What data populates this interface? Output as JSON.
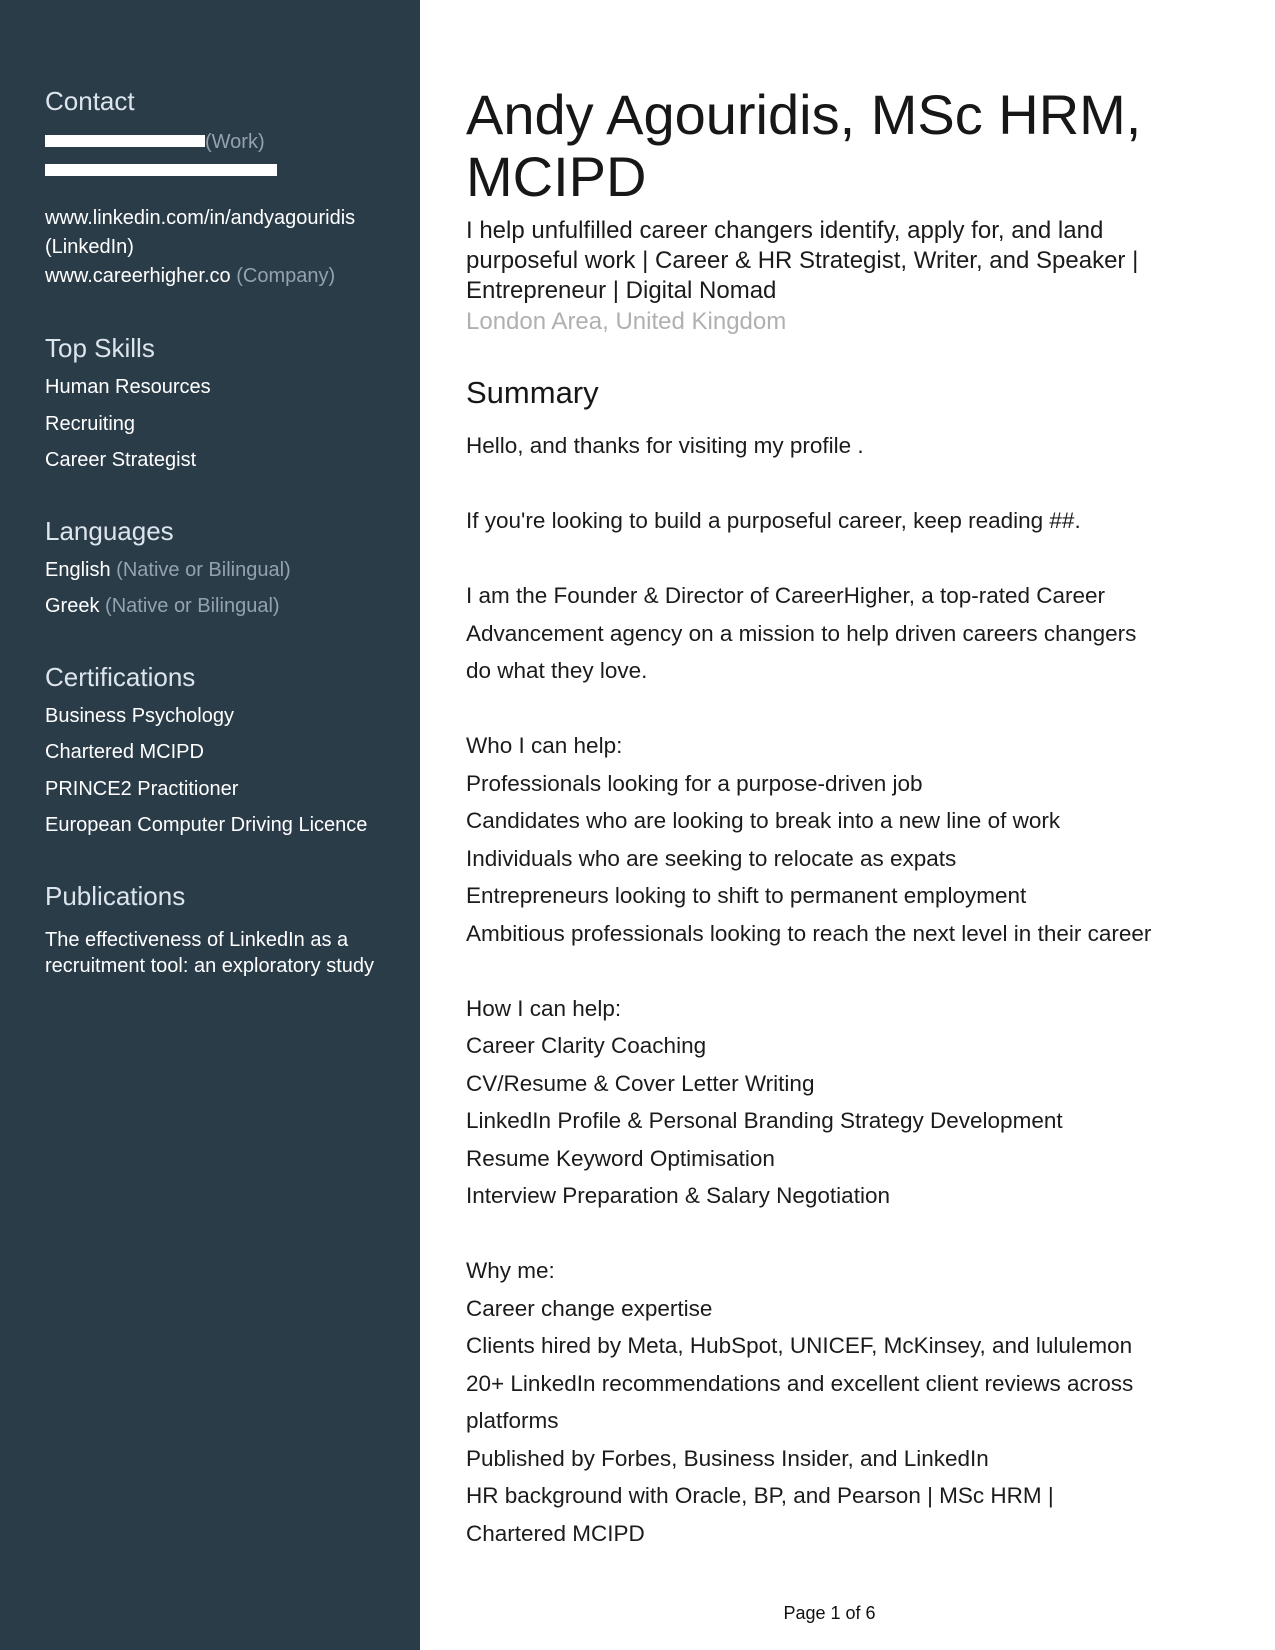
{
  "sidebar": {
    "contact": {
      "heading": "Contact",
      "phone_label": "(Work)",
      "linkedin_url": "www.linkedin.com/in/andyagouridis",
      "linkedin_label": "(LinkedIn)",
      "website_url": "www.careerhigher.co",
      "website_label": "(Company)"
    },
    "top_skills": {
      "heading": "Top Skills",
      "items": [
        "Human Resources",
        "Recruiting",
        "Career Strategist"
      ]
    },
    "languages": {
      "heading": "Languages",
      "items": [
        {
          "name": "English",
          "level": "(Native or Bilingual)"
        },
        {
          "name": "Greek",
          "level": "(Native or Bilingual)"
        }
      ]
    },
    "certifications": {
      "heading": "Certifications",
      "items": [
        "Business Psychology",
        "Chartered MCIPD",
        "PRINCE2 Practitioner",
        "European Computer Driving Licence"
      ]
    },
    "publications": {
      "heading": "Publications",
      "lines": [
        "The effectiveness of LinkedIn as a",
        "recruitment tool: an exploratory study"
      ]
    }
  },
  "main": {
    "name_lines": [
      "Andy Agouridis, MSc HRM,",
      "MCIPD"
    ],
    "headline_lines": [
      "I help unfulfilled career changers identify, apply for, and land",
      "purposeful work | Career & HR Strategist, Writer, and Speaker |",
      "Entrepreneur | Digital Nomad"
    ],
    "location": "London Area, United Kingdom",
    "summary_heading": "Summary",
    "summary_lines": [
      "Hello, and thanks for visiting my profile .",
      "",
      "If you're looking to build a purposeful career, keep reading ##.",
      "",
      "I am the Founder & Director of CareerHigher, a top-rated Career",
      "Advancement agency on a mission to help driven careers changers",
      "do what they love.",
      "",
      "Who I can help:",
      "Professionals looking for a purpose-driven job",
      "Candidates who are looking to break into a new line of work",
      "Individuals who are seeking to relocate as expats",
      "Entrepreneurs looking to shift to permanent employment",
      "Ambitious professionals looking to reach the next level in their career",
      "",
      "How I can help:",
      "Career Clarity Coaching",
      "CV/Resume & Cover Letter Writing",
      "LinkedIn Profile & Personal Branding Strategy Development",
      "Resume Keyword Optimisation",
      "Interview Preparation & Salary Negotiation",
      "",
      "Why me:",
      "Career change expertise",
      "Clients hired by Meta, HubSpot, UNICEF, McKinsey, and lululemon",
      "20+ LinkedIn recommendations and excellent client reviews across",
      "platforms",
      "Published by Forbes, Business Insider, and LinkedIn",
      "HR background with Oracle, BP, and Pearson | MSc HRM |",
      "Chartered MCIPD"
    ]
  },
  "footer": {
    "page_label": "Page 1 of 6"
  }
}
